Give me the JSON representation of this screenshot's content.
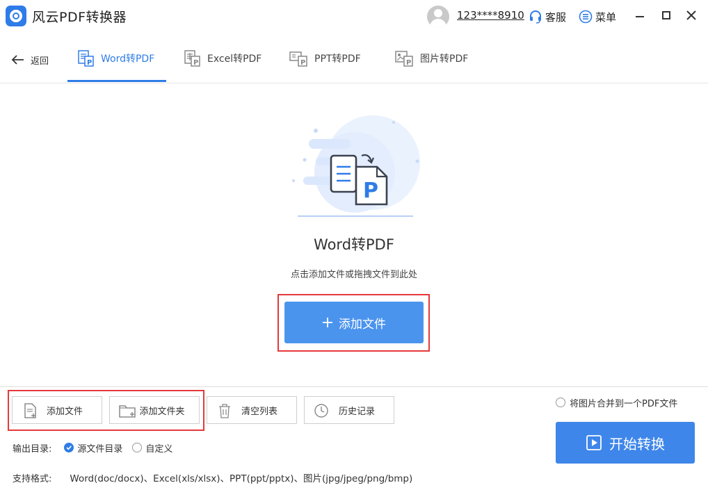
{
  "app": {
    "title": "风云PDF转换器"
  },
  "account": {
    "username": "123****8910"
  },
  "header": {
    "service_label": "客服",
    "menu_label": "菜单"
  },
  "nav": {
    "back_label": "返回",
    "tabs": [
      {
        "label": "Word转PDF",
        "icon": "word-doc-icon",
        "active": true
      },
      {
        "label": "Excel转PDF",
        "icon": "excel-doc-icon",
        "active": false
      },
      {
        "label": "PPT转PDF",
        "icon": "ppt-doc-icon",
        "active": false
      },
      {
        "label": "图片转PDF",
        "icon": "image-doc-icon",
        "active": false
      }
    ]
  },
  "dropzone": {
    "title": "Word转PDF",
    "hint": "点击添加文件或拖拽文件到此处",
    "add_file_label": "添加文件"
  },
  "toolbar": {
    "add_file_label": "添加文件",
    "add_folder_label": "添加文件夹",
    "clear_list_label": "清空列表",
    "history_label": "历史记录"
  },
  "options": {
    "merge_images_label": "将图片合并到一个PDF文件",
    "merge_images_checked": false,
    "output_dir_label": "输出目录:",
    "output_source_label": "源文件目录",
    "output_source_selected": true,
    "output_custom_label": "自定义",
    "output_custom_selected": false,
    "formats_label": "支持格式:",
    "formats_value": "Word(doc/docx)、Excel(xls/xlsx)、PPT(ppt/pptx)、图片(jpg/jpeg/png/bmp)"
  },
  "actions": {
    "start_label": "开始转换"
  },
  "colors": {
    "accent": "#2f7ce8",
    "button_blue": "#4b94ee",
    "highlight_red": "#e5383b"
  }
}
